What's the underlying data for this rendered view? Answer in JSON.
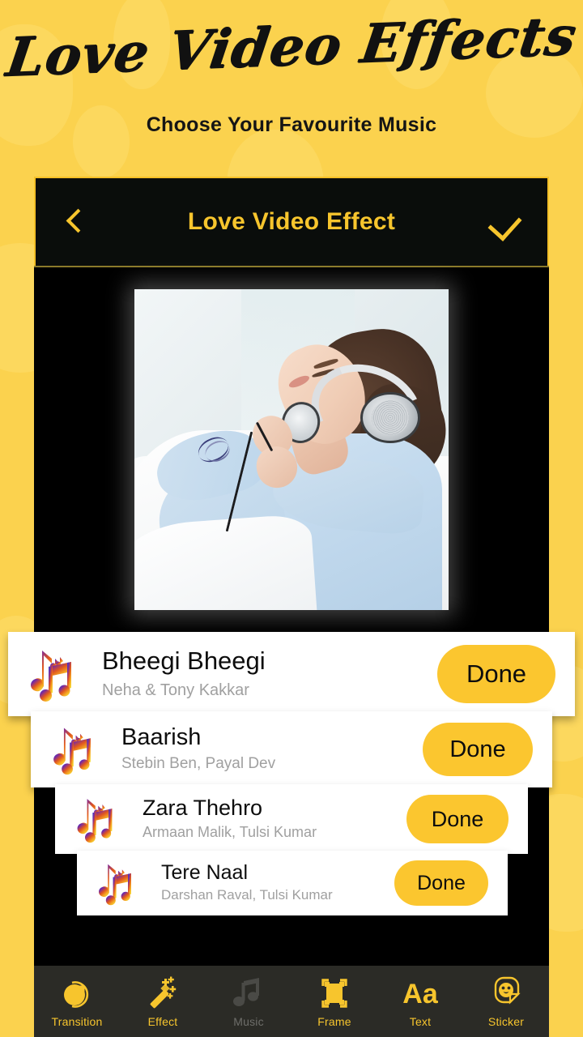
{
  "header": {
    "title": "Love Video Effects",
    "subtitle": "Choose Your Favourite Music"
  },
  "appbar": {
    "title": "Love Video Effect",
    "back_icon": "chevron-left-icon",
    "confirm_icon": "check-icon"
  },
  "preview": {
    "description": "Woman reclining on a white couch listening to music with silver over-ear headphones"
  },
  "songs": [
    {
      "title": "Bheegi Bheegi",
      "artist": "Neha & Tony Kakkar",
      "action_label": "Done",
      "icon": "music-note-icon"
    },
    {
      "title": "Baarish",
      "artist": "Stebin Ben, Payal Dev",
      "action_label": "Done",
      "icon": "music-note-icon"
    },
    {
      "title": "Zara Thehro",
      "artist": "Armaan Malik, Tulsi Kumar",
      "action_label": "Done",
      "icon": "music-note-icon"
    },
    {
      "title": "Tere Naal",
      "artist": "Darshan Raval, Tulsi Kumar",
      "action_label": "Done",
      "icon": "music-note-icon"
    }
  ],
  "toolbar": {
    "items": [
      {
        "label": "Transition",
        "icon": "transition-icon",
        "active": false
      },
      {
        "label": "Effect",
        "icon": "magic-wand-icon",
        "active": false
      },
      {
        "label": "Music",
        "icon": "music-note-icon",
        "active": true
      },
      {
        "label": "Frame",
        "icon": "frame-icon",
        "active": false
      },
      {
        "label": "Text",
        "icon": "text-aa-icon",
        "active": false
      },
      {
        "label": "Sticker",
        "icon": "sticker-icon",
        "active": false
      }
    ]
  },
  "colors": {
    "background_yellow": "#FBD24E",
    "accent_yellow": "#F7C52D",
    "button_yellow": "#FBC62F",
    "panel_black": "#000000",
    "toolbar_dark": "#2B2B26",
    "muted_gray": "#A0A0A0",
    "disabled_gray": "#6E6E6A"
  }
}
